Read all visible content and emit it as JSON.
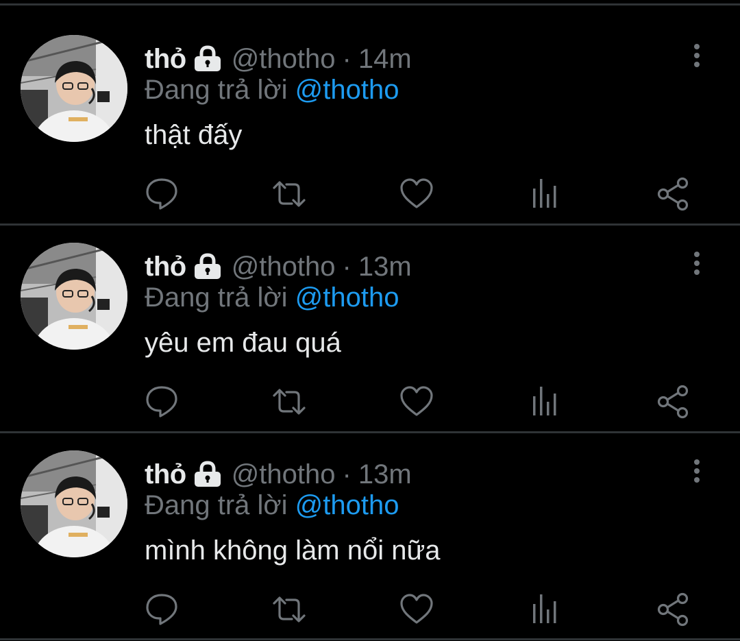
{
  "colors": {
    "background": "#000000",
    "divider": "#2f3336",
    "primary_text": "#e7e9ea",
    "secondary_text": "#71767b",
    "mention": "#1d9bf0"
  },
  "tweets": [
    {
      "name": "thỏ",
      "handle": "@thotho",
      "separator": "·",
      "time": "14m",
      "reply_prefix": "Đang trả lời",
      "reply_to": "@thotho",
      "text": "thật đấy"
    },
    {
      "name": "thỏ",
      "handle": "@thotho",
      "separator": "·",
      "time": "13m",
      "reply_prefix": "Đang trả lời",
      "reply_to": "@thotho",
      "text": "yêu em đau quá"
    },
    {
      "name": "thỏ",
      "handle": "@thotho",
      "separator": "·",
      "time": "13m",
      "reply_prefix": "Đang trả lời",
      "reply_to": "@thotho",
      "text": "mình không làm nổi nữa"
    }
  ],
  "icons": {
    "lock": "lock-icon",
    "more": "more-vertical-icon",
    "reply": "reply-bubble-icon",
    "retweet": "retweet-icon",
    "like": "heart-icon",
    "views": "bar-chart-icon",
    "share": "share-icon"
  }
}
